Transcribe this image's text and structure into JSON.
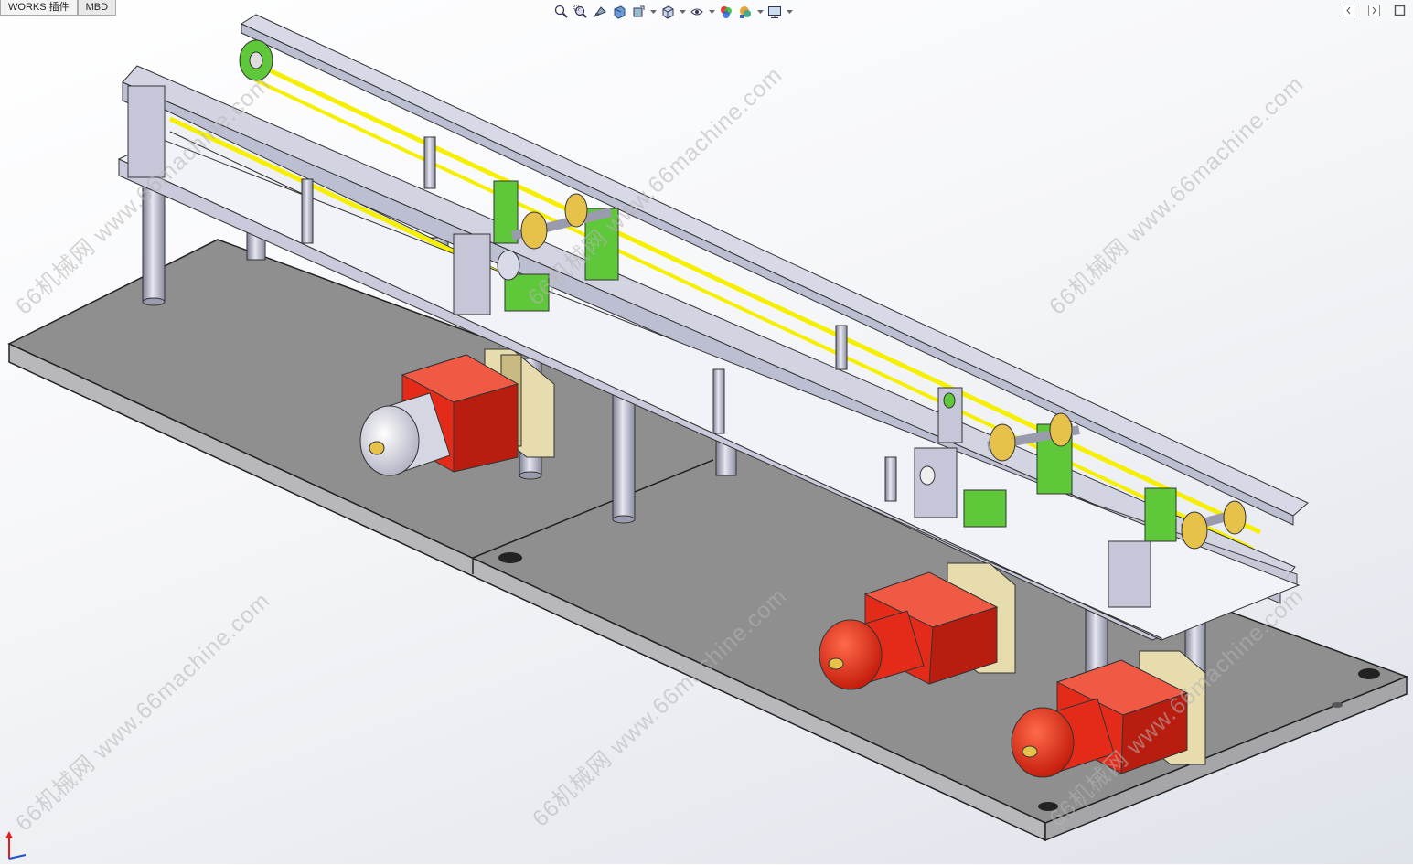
{
  "tabs": [
    {
      "label": "WORKS 插件",
      "active": true
    },
    {
      "label": "MBD",
      "active": false
    }
  ],
  "heads_up_toolbar": [
    {
      "icon": "zoom-to-fit-icon"
    },
    {
      "icon": "zoom-to-area-icon"
    },
    {
      "icon": "previous-view-icon"
    },
    {
      "icon": "section-view-icon"
    },
    {
      "icon": "dynamic-annotation-view-icon"
    },
    {
      "icon": "view-orientation-icon",
      "has_dropdown": true
    },
    {
      "icon": "display-style-icon",
      "has_dropdown": true
    },
    {
      "icon": "hide-show-items-icon",
      "has_dropdown": true
    },
    {
      "icon": "edit-appearance-icon"
    },
    {
      "icon": "apply-scene-icon",
      "has_dropdown": true
    },
    {
      "icon": "view-settings-icon",
      "has_dropdown": true
    }
  ],
  "window_controls": [
    "tile-left-icon",
    "tile-right-icon",
    "maximize-icon"
  ],
  "watermark": "66机械网 www.66machine.com",
  "colors": {
    "base_plate": "#8f8f8f",
    "frame": "#c9cbdc",
    "belt": "#f5f000",
    "bearing_block": "#5ec83a",
    "gearbox": "#e42b1a",
    "motor": "#e8e8ee",
    "support_post": "#b4b6c8"
  }
}
